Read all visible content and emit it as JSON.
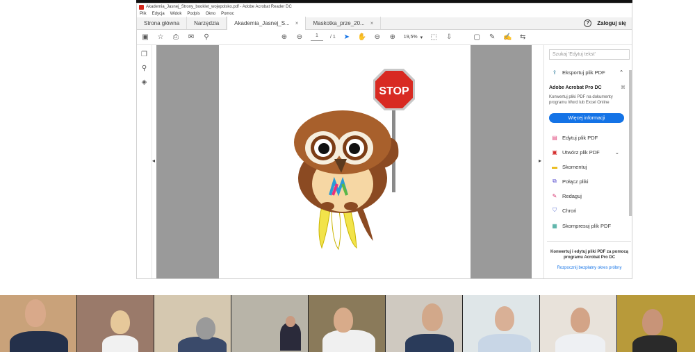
{
  "window": {
    "title": "Akademia_Jasnej_Strony_booklet_wojepolsko.pdf - Adobe Acrobat Reader DC"
  },
  "menu": [
    "Plik",
    "Edycja",
    "Widok",
    "Podpis",
    "Okno",
    "Pomoc"
  ],
  "tabs": {
    "home": "Strona główna",
    "tools": "Narzędzia",
    "doc1": "Akademia_Jasnej_S...",
    "doc2": "Maskotka_prze_20..."
  },
  "header": {
    "signin": "Zaloguj się",
    "help": "?"
  },
  "toolbar": {
    "page_current": "1",
    "page_total": "/ 1",
    "zoom": "19,5%"
  },
  "panel": {
    "search_placeholder": "Szukaj 'Edytuj tekst'",
    "export": "Eksportuj plik PDF",
    "promo_title": "Adobe Acrobat Pro DC",
    "promo_text": "Konwertuj pliki PDF na dokumenty programu Word lub Excel Online",
    "promo_button": "Więcej informacji",
    "tools": [
      "Edytuj plik PDF",
      "Utwórz plik PDF",
      "Skomentuj",
      "Połącz pliki",
      "Redaguj",
      "Chroń",
      "Skompresuj plik PDF"
    ],
    "bottom_text": "Konwertuj i edytuj pliki PDF za pomocą programu Acrobat Pro DC",
    "bottom_link": "Rozpocznij bezpłatny okres próbny"
  },
  "document": {
    "sign_text": "STOP"
  },
  "colors": {
    "accent": "#1473e6",
    "stop_red": "#d82a22",
    "owl_brown": "#8b4a22"
  }
}
